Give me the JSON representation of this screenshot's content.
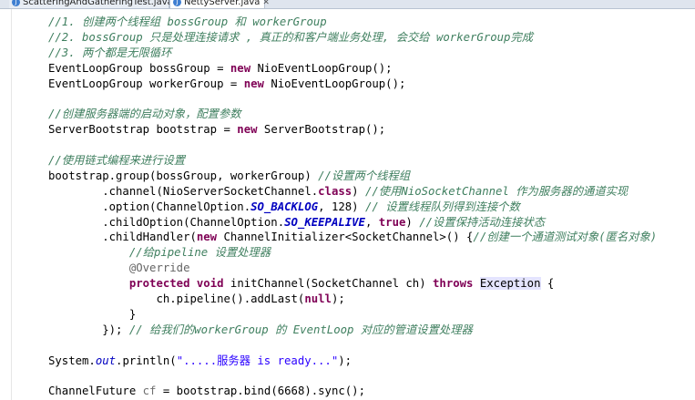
{
  "tabs": [
    {
      "label": "ScatteringAndGatheringTest.java",
      "active": false
    },
    {
      "label": "NettyServer.java",
      "active": true
    }
  ],
  "code_lines": [
    [
      {
        "t": "//1. 创建两个线程组 bossGroup 和 workerGroup",
        "c": "cm"
      }
    ],
    [
      {
        "t": "//2. bossGroup 只是处理连接请求 , 真正的和客户端业务处理, 会交给 workerGroup完成",
        "c": "cm"
      }
    ],
    [
      {
        "t": "//3. 两个都是无限循环",
        "c": "cm"
      }
    ],
    [
      {
        "t": "EventLoopGroup bossGroup = ",
        "c": ""
      },
      {
        "t": "new",
        "c": "kw"
      },
      {
        "t": " NioEventLoopGroup();",
        "c": ""
      }
    ],
    [
      {
        "t": "EventLoopGroup workerGroup = ",
        "c": ""
      },
      {
        "t": "new",
        "c": "kw"
      },
      {
        "t": " NioEventLoopGroup();",
        "c": ""
      }
    ],
    [],
    [
      {
        "t": "//创建服务器端的启动对象，配置参数",
        "c": "cm"
      }
    ],
    [
      {
        "t": "ServerBootstrap bootstrap = ",
        "c": ""
      },
      {
        "t": "new",
        "c": "kw"
      },
      {
        "t": " ServerBootstrap();",
        "c": ""
      }
    ],
    [],
    [
      {
        "t": "//使用链式编程来进行设置",
        "c": "cm"
      }
    ],
    [
      {
        "t": "bootstrap.group(bossGroup, workerGroup) ",
        "c": ""
      },
      {
        "t": "//设置两个线程组",
        "c": "cm"
      }
    ],
    [
      {
        "t": "        .channel(NioServerSocketChannel.",
        "c": ""
      },
      {
        "t": "class",
        "c": "kw"
      },
      {
        "t": ") ",
        "c": ""
      },
      {
        "t": "//使用NioSocketChannel 作为服务器的通道实现",
        "c": "cm"
      }
    ],
    [
      {
        "t": "        .option(ChannelOption.",
        "c": ""
      },
      {
        "t": "SO_BACKLOG",
        "c": "sfb"
      },
      {
        "t": ", 128) ",
        "c": ""
      },
      {
        "t": "// 设置线程队列得到连接个数",
        "c": "cm"
      }
    ],
    [
      {
        "t": "        .childOption(ChannelOption.",
        "c": ""
      },
      {
        "t": "SO_KEEPALIVE",
        "c": "sfb"
      },
      {
        "t": ", ",
        "c": ""
      },
      {
        "t": "true",
        "c": "kw"
      },
      {
        "t": ") ",
        "c": ""
      },
      {
        "t": "//设置保持活动连接状态",
        "c": "cm"
      }
    ],
    [
      {
        "t": "        .childHandler(",
        "c": ""
      },
      {
        "t": "new",
        "c": "kw"
      },
      {
        "t": " ChannelInitializer<SocketChannel>() {",
        "c": ""
      },
      {
        "t": "//创建一个通道测试对象(匿名对象)",
        "c": "cm"
      }
    ],
    [
      {
        "t": "            ",
        "c": ""
      },
      {
        "t": "//给pipeline 设置处理器",
        "c": "cm"
      }
    ],
    [
      {
        "t": "            ",
        "c": ""
      },
      {
        "t": "@Override",
        "c": "an"
      }
    ],
    [
      {
        "t": "            ",
        "c": ""
      },
      {
        "t": "protected",
        "c": "kw"
      },
      {
        "t": " ",
        "c": ""
      },
      {
        "t": "void",
        "c": "kw"
      },
      {
        "t": " initChannel(SocketChannel ch) ",
        "c": ""
      },
      {
        "t": "throws",
        "c": "kw"
      },
      {
        "t": " ",
        "c": ""
      },
      {
        "t": "Exception",
        "c": "hl"
      },
      {
        "t": " {",
        "c": ""
      }
    ],
    [
      {
        "t": "                ch.pipeline().addLast(",
        "c": ""
      },
      {
        "t": "null",
        "c": "kw"
      },
      {
        "t": ");",
        "c": ""
      }
    ],
    [
      {
        "t": "            }",
        "c": ""
      }
    ],
    [
      {
        "t": "        }); ",
        "c": ""
      },
      {
        "t": "// 给我们的workerGroup 的 EventLoop 对应的管道设置处理器",
        "c": "cm"
      }
    ],
    [],
    [
      {
        "t": "System.",
        "c": ""
      },
      {
        "t": "out",
        "c": "sf"
      },
      {
        "t": ".println(",
        "c": ""
      },
      {
        "t": "\".....服务器 is ready...\"",
        "c": "st"
      },
      {
        "t": ");",
        "c": ""
      }
    ],
    [],
    [
      {
        "t": "ChannelFuture ",
        "c": ""
      },
      {
        "t": "cf",
        "c": "unused"
      },
      {
        "t": " = bootstrap.bind(6668).sync();",
        "c": ""
      }
    ]
  ]
}
